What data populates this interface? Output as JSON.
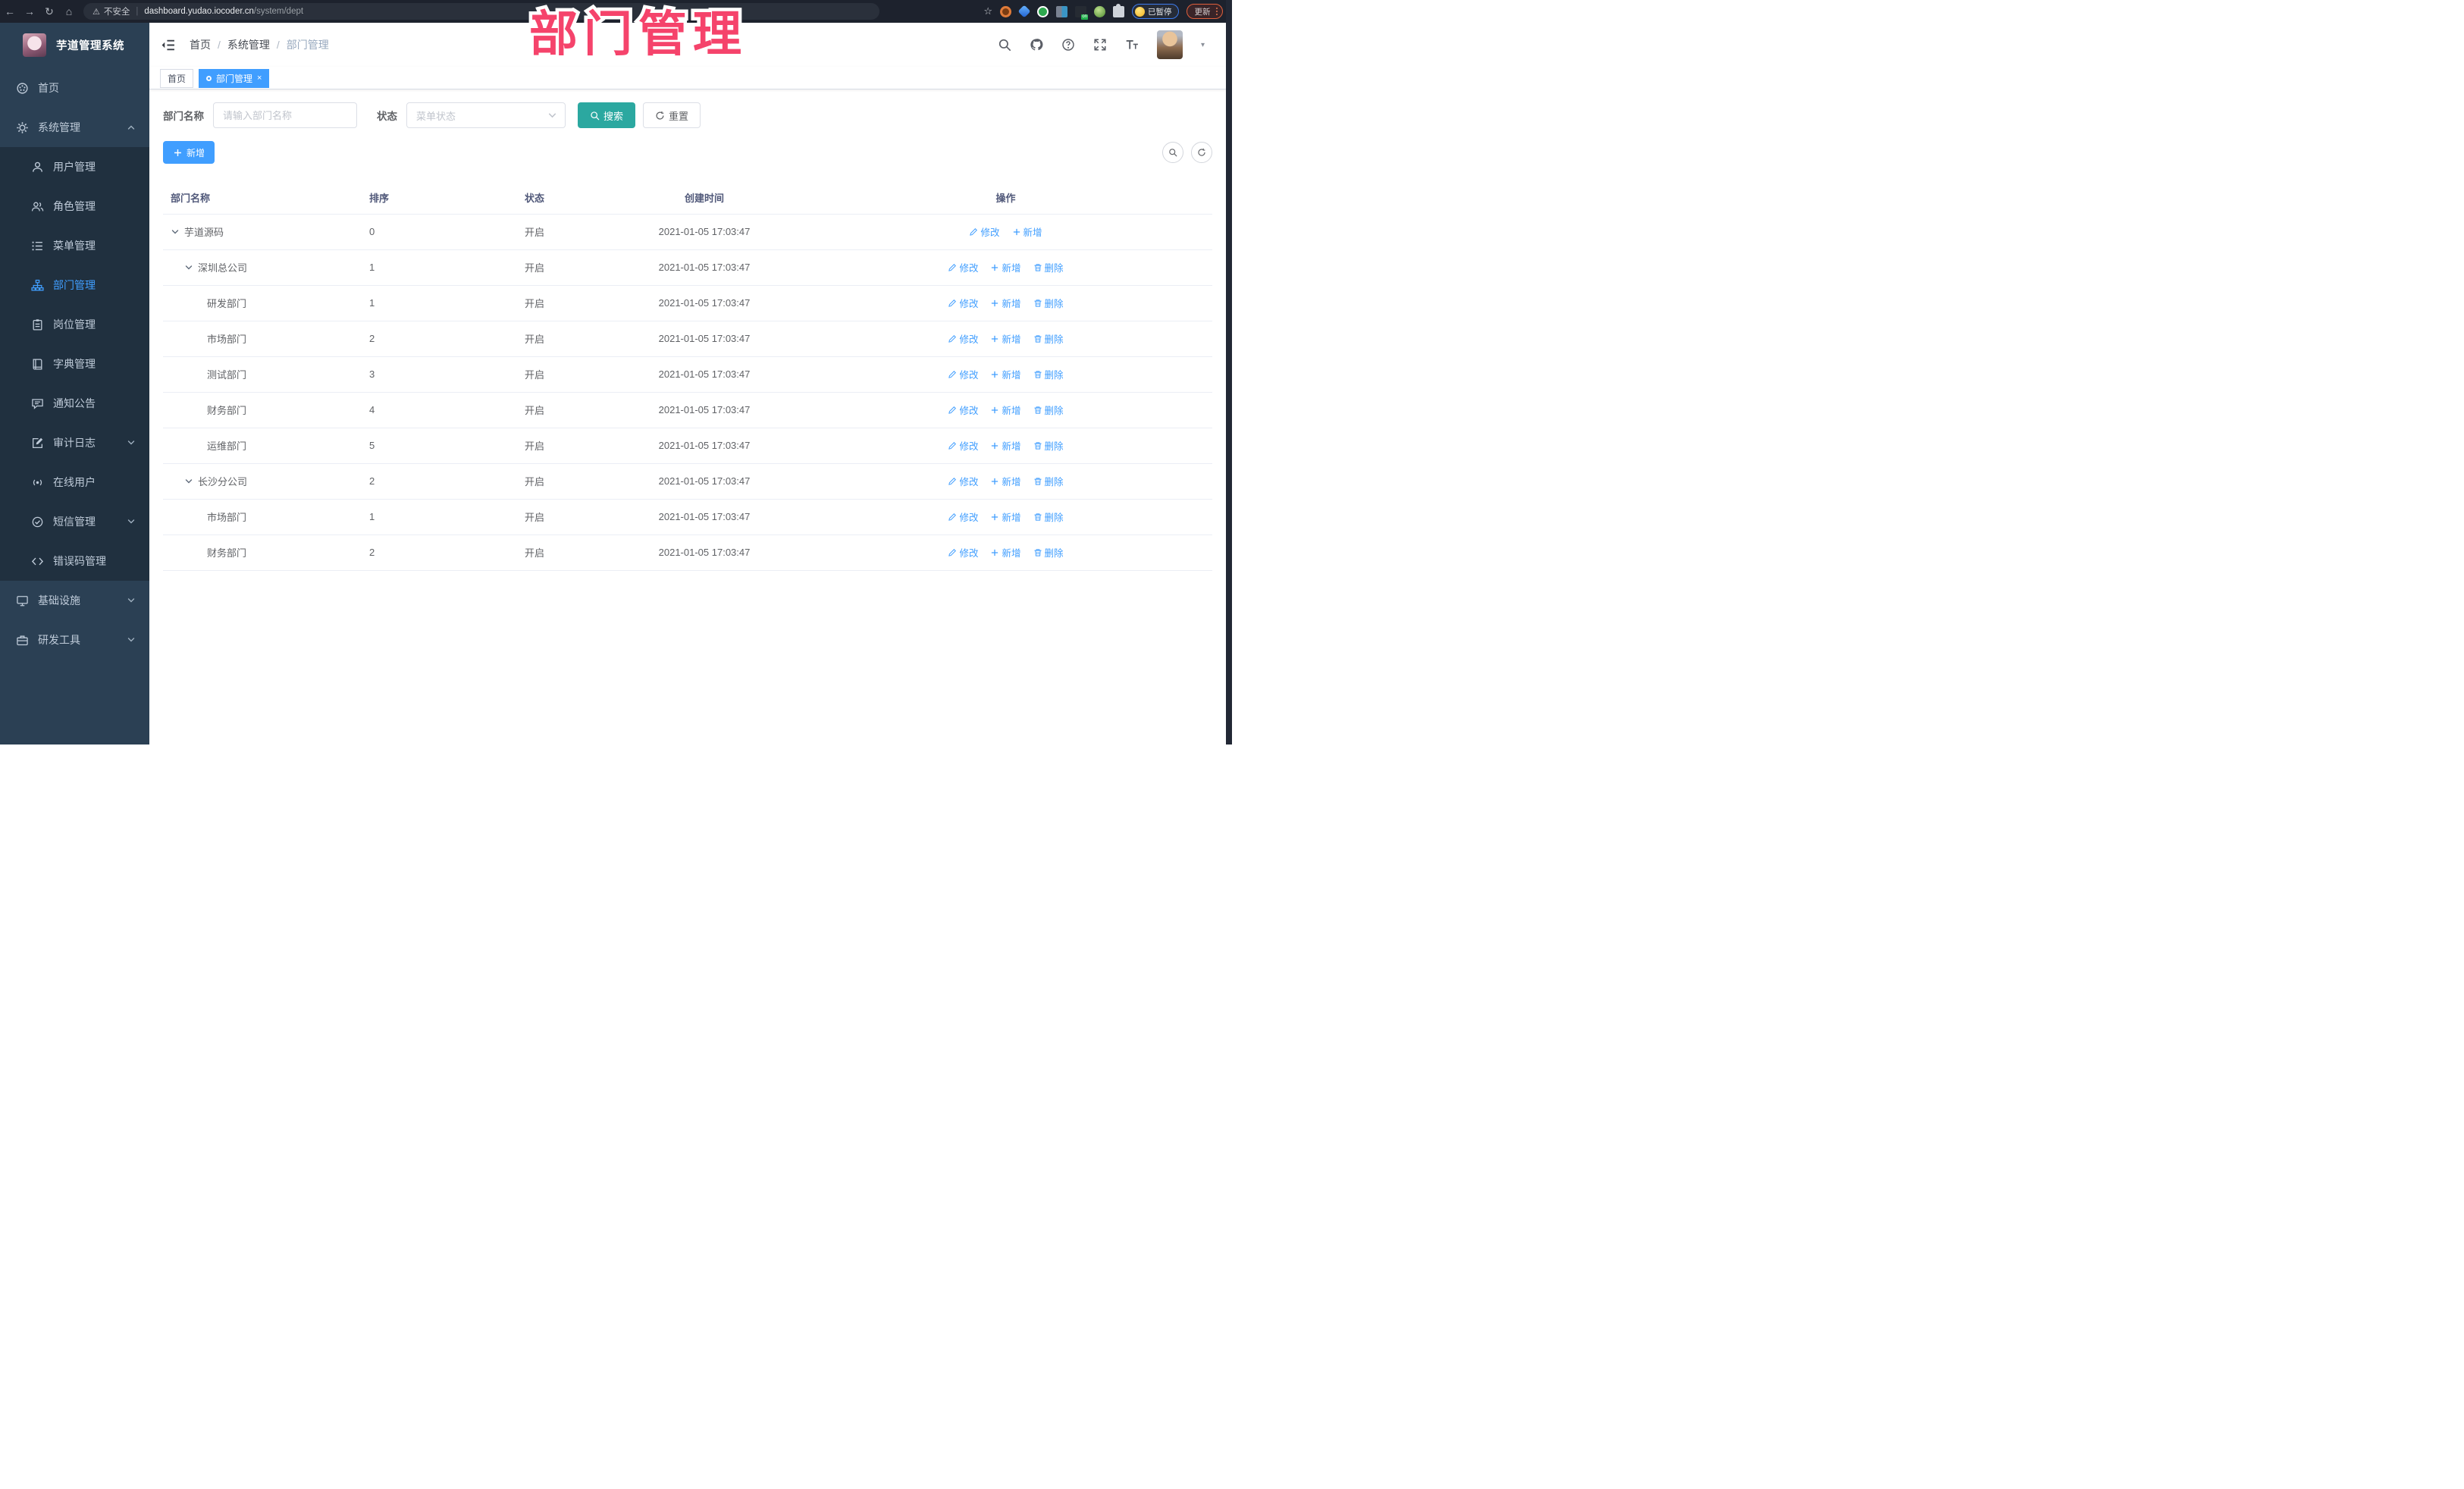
{
  "browser": {
    "nav": {
      "back": "←",
      "forward": "→",
      "reload": "↻",
      "home": "⌂"
    },
    "security": {
      "warning_icon": "⚠",
      "label": "不安全"
    },
    "url": {
      "host": "dashboard.yudao.iocoder.cn",
      "path": "/system/dept"
    },
    "bookmark_star": "☆",
    "profile_chip_label": "已暂停",
    "update_button_label": "更新"
  },
  "watermark": "部门管理",
  "sidebar": {
    "title": "芋道管理系统",
    "items": [
      {
        "label": "首页",
        "icon": "dashboard-icon"
      },
      {
        "label": "系统管理",
        "icon": "gear-icon",
        "expanded": true
      },
      {
        "label": "用户管理",
        "icon": "user-icon"
      },
      {
        "label": "角色管理",
        "icon": "users-icon"
      },
      {
        "label": "菜单管理",
        "icon": "list-icon"
      },
      {
        "label": "部门管理",
        "icon": "org-tree-icon",
        "active": true
      },
      {
        "label": "岗位管理",
        "icon": "badge-icon"
      },
      {
        "label": "字典管理",
        "icon": "book-icon"
      },
      {
        "label": "通知公告",
        "icon": "message-icon"
      },
      {
        "label": "审计日志",
        "icon": "edit-doc-icon",
        "collapsible": true
      },
      {
        "label": "在线用户",
        "icon": "online-icon"
      },
      {
        "label": "短信管理",
        "icon": "check-circle-icon",
        "collapsible": true
      },
      {
        "label": "错误码管理",
        "icon": "code-icon"
      },
      {
        "label": "基础设施",
        "icon": "monitor-icon",
        "collapsible": true
      },
      {
        "label": "研发工具",
        "icon": "toolbox-icon",
        "collapsible": true
      }
    ]
  },
  "header": {
    "breadcrumb": [
      "首页",
      "系统管理",
      "部门管理"
    ],
    "icons": [
      "search-icon",
      "github-icon",
      "help-icon",
      "fullscreen-icon",
      "font-size-icon",
      "avatar",
      "caret-down-icon"
    ]
  },
  "tabs": [
    {
      "label": "首页",
      "active": false
    },
    {
      "label": "部门管理",
      "active": true,
      "closable": true
    }
  ],
  "filters": {
    "dept_label": "部门名称",
    "dept_placeholder": "请输入部门名称",
    "status_label": "状态",
    "status_placeholder": "菜单状态",
    "search_label": "搜索",
    "reset_label": "重置"
  },
  "toolbar": {
    "add_label": "新增"
  },
  "table": {
    "headers": [
      "部门名称",
      "排序",
      "状态",
      "创建时间",
      "操作"
    ],
    "action_labels": {
      "edit": "修改",
      "add": "新增",
      "delete": "删除"
    },
    "rows": [
      {
        "name": "芋道源码",
        "level": 0,
        "expandable": true,
        "sort": "0",
        "status": "开启",
        "time": "2021-01-05 17:03:47",
        "has_delete": false
      },
      {
        "name": "深圳总公司",
        "level": 1,
        "expandable": true,
        "sort": "1",
        "status": "开启",
        "time": "2021-01-05 17:03:47",
        "has_delete": true
      },
      {
        "name": "研发部门",
        "level": 2,
        "expandable": false,
        "sort": "1",
        "status": "开启",
        "time": "2021-01-05 17:03:47",
        "has_delete": true
      },
      {
        "name": "市场部门",
        "level": 2,
        "expandable": false,
        "sort": "2",
        "status": "开启",
        "time": "2021-01-05 17:03:47",
        "has_delete": true
      },
      {
        "name": "测试部门",
        "level": 2,
        "expandable": false,
        "sort": "3",
        "status": "开启",
        "time": "2021-01-05 17:03:47",
        "has_delete": true
      },
      {
        "name": "财务部门",
        "level": 2,
        "expandable": false,
        "sort": "4",
        "status": "开启",
        "time": "2021-01-05 17:03:47",
        "has_delete": true
      },
      {
        "name": "运维部门",
        "level": 2,
        "expandable": false,
        "sort": "5",
        "status": "开启",
        "time": "2021-01-05 17:03:47",
        "has_delete": true
      },
      {
        "name": "长沙分公司",
        "level": 1,
        "expandable": true,
        "sort": "2",
        "status": "开启",
        "time": "2021-01-05 17:03:47",
        "has_delete": true
      },
      {
        "name": "市场部门",
        "level": 2,
        "expandable": false,
        "sort": "1",
        "status": "开启",
        "time": "2021-01-05 17:03:47",
        "has_delete": true
      },
      {
        "name": "财务部门",
        "level": 2,
        "expandable": false,
        "sort": "2",
        "status": "开启",
        "time": "2021-01-05 17:03:47",
        "has_delete": true
      }
    ]
  },
  "colors": {
    "accent_blue": "#409eff",
    "teal_button": "#2ba8a0",
    "watermark_pink": "#f5436b",
    "sidebar_bg": "#2b4054",
    "sidebar_submenu_bg": "#20303f",
    "chrome_bg": "#1d222d"
  }
}
